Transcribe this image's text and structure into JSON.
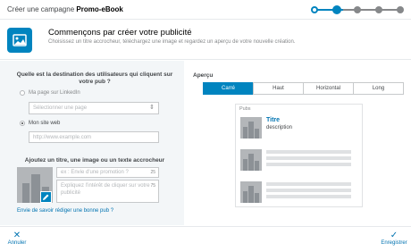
{
  "header": {
    "title_prefix": "Créer une campagne",
    "title_bold": "Promo-eBook"
  },
  "intro": {
    "icon": "image-icon",
    "title": "Commençons par créer votre publicité",
    "subtitle": "Choisissez un titre accrocheur, téléchargez une image et regardez un aperçu de votre nouvelle création."
  },
  "destination": {
    "question": "Quelle est la destination des utilisateurs qui cliquent sur votre pub ?",
    "option_linkedin": "Ma page sur LinkedIn",
    "page_select_placeholder": "Sélectionner une page",
    "option_website": "Mon site web",
    "url_placeholder": "http://www.example.com"
  },
  "creative": {
    "heading": "Ajoutez un titre, une image ou un texte accrocheur",
    "promo_placeholder": "ex : Envie d'une promotion ?",
    "promo_count": "25",
    "desc_placeholder": "Expliquez l'intérêt de cliquer sur votre publicité",
    "desc_count": "75",
    "tip_link": "Envie de savoir rédiger une bonne pub ?"
  },
  "preview": {
    "label": "Aperçu",
    "tabs": [
      "Carré",
      "Haut",
      "Horizontal",
      "Long"
    ],
    "card_header": "Pubs",
    "ad_title": "Titre",
    "ad_desc": "description"
  },
  "footer": {
    "cancel": "Annuler",
    "save": "Enregistrer"
  },
  "colors": {
    "accent": "#0084bf",
    "link": "#0073b1"
  }
}
